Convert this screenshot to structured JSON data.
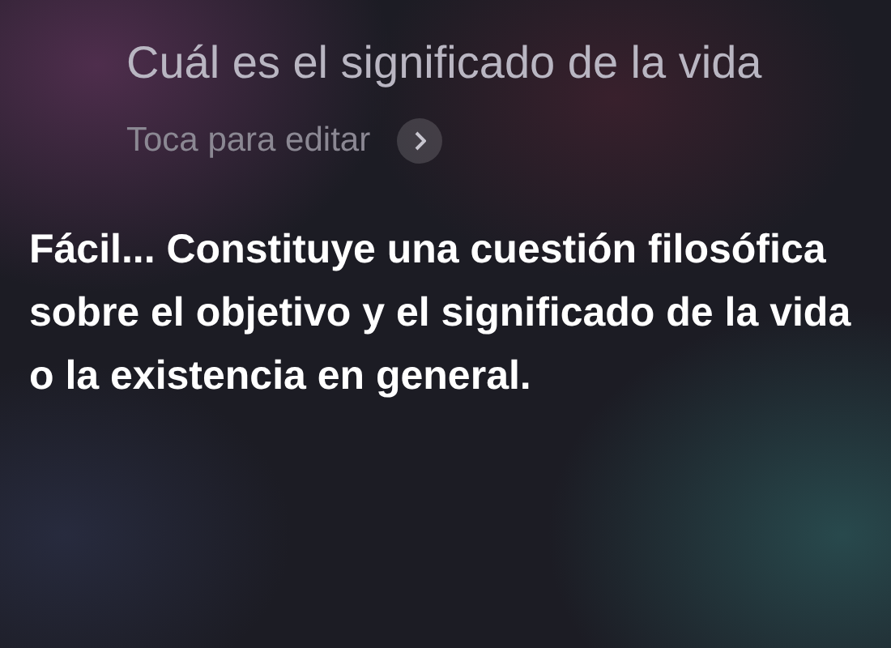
{
  "query": "Cuál es el significado de la vida",
  "edit_hint": "Toca para editar",
  "answer": "Fácil... Constituye una cuestión filosófica sobre el objetivo y el significado de la vida o la existencia en general."
}
